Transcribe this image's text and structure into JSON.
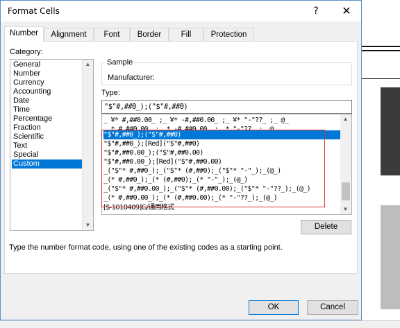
{
  "dialog": {
    "title": "Format Cells",
    "help_label": "?",
    "close_label": "✕"
  },
  "tabs": [
    {
      "label": "Number",
      "active": true
    },
    {
      "label": "Alignment"
    },
    {
      "label": "Font"
    },
    {
      "label": "Border"
    },
    {
      "label": "Fill"
    },
    {
      "label": "Protection"
    }
  ],
  "category": {
    "label": "Category:",
    "items": [
      "General",
      "Number",
      "Currency",
      "Accounting",
      "Date",
      "Time",
      "Percentage",
      "Fraction",
      "Scientific",
      "Text",
      "Special",
      "Custom"
    ],
    "selected": "Custom"
  },
  "sample": {
    "label": "Sample",
    "value": "Manufacturer:"
  },
  "type": {
    "label": "Type:",
    "value": "\"$\"#,##0_);(\"$\"#,##0)"
  },
  "format_list": {
    "items": [
      "_ ¥* #,##0.00_ ;_ ¥* -#,##0.00_ ;_ ¥* \"-\"??_ ;_ @_",
      "_ * #,##0.00_ ;_ * -#,##0.00_ ;_ * \"-\"??_ ;_ @_",
      "\"$\"#,##0_);(\"$\"#,##0)",
      "\"$\"#,##0_);[Red](\"$\"#,##0)",
      "\"$\"#,##0.00_);(\"$\"#,##0.00)",
      "\"$\"#,##0.00_);[Red](\"$\"#,##0.00)",
      "_(\"$\"* #,##0_);_(\"$\"* (#,##0);_(\"$\"* \"-\"_);_(@_)",
      "_(* #,##0_);_(* (#,##0);_(* \"-\"_);_(@_)",
      "_(\"$\"* #,##0.00_);_(\"$\"* (#,##0.00);_(\"$\"* \"-\"??_);_(@_)",
      "_(* #,##0.00_);_(* (#,##0.00);_(* \"-\"??_);_(@_)",
      "[$-1010409]G/通用格式"
    ],
    "selected_index": 2
  },
  "buttons": {
    "delete": "Delete",
    "ok": "OK",
    "cancel": "Cancel"
  },
  "description": "Type the number format code, using one of the existing codes as a starting point.",
  "colors": {
    "selection": "#0078d7",
    "highlight_box": "#e03030"
  }
}
